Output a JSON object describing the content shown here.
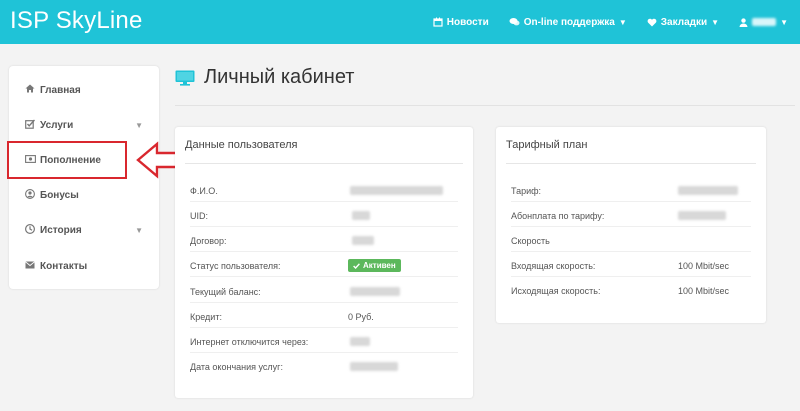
{
  "brand": "ISP SkyLine",
  "nav": {
    "news": "Новости",
    "support": "On-line поддержка",
    "bookmarks": "Закладки"
  },
  "sidebar": {
    "items": [
      {
        "label": "Главная",
        "icon": "home-icon"
      },
      {
        "label": "Услуги",
        "icon": "checkbox-icon",
        "has_caret": true
      },
      {
        "label": "Пополнение",
        "icon": "money-icon"
      },
      {
        "label": "Бонусы",
        "icon": "user-circle-icon"
      },
      {
        "label": "История",
        "icon": "clock-icon",
        "has_caret": true
      },
      {
        "label": "Контакты",
        "icon": "envelope-icon"
      }
    ],
    "highlighted_item": "Пополнение",
    "highlight_color": "#d9272e"
  },
  "page": {
    "title": "Личный кабинет"
  },
  "user_card": {
    "title": "Данные пользователя",
    "rows": [
      {
        "label": "Ф.И.О."
      },
      {
        "label": "UID:"
      },
      {
        "label": "Договор:"
      },
      {
        "label": "Статус пользователя:",
        "badge": "Активен"
      },
      {
        "label": "Текущий баланс:"
      },
      {
        "label": "Кредит:",
        "value": "0 Руб."
      },
      {
        "label": "Интернет отключится через:"
      },
      {
        "label": "Дата окончания услуг:"
      }
    ]
  },
  "tariff_card": {
    "title": "Тарифный план",
    "rows": [
      {
        "label": "Тариф:"
      },
      {
        "label": "Абонплата по тарифу:"
      },
      {
        "label": "Скорость"
      },
      {
        "label": "Входящая скорость:",
        "value": "100 Mbit/sec"
      },
      {
        "label": "Исходящая скорость:",
        "value": "100 Mbit/sec"
      }
    ]
  },
  "colors": {
    "topbar": "#1fc3d7",
    "badge_active": "#5cb85c",
    "highlight": "#d9272e"
  }
}
